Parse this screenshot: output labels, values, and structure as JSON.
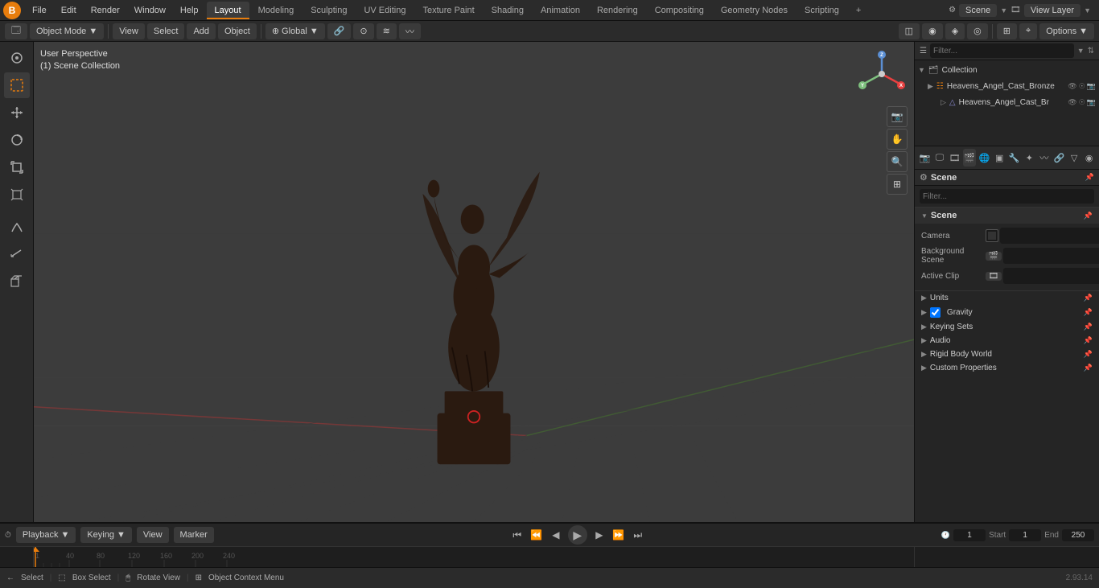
{
  "app": {
    "logo": "B",
    "version": "2.93.14"
  },
  "top_menu": {
    "items": [
      "File",
      "Edit",
      "Render",
      "Window",
      "Help"
    ]
  },
  "workspace_tabs": {
    "items": [
      "Layout",
      "Modeling",
      "Sculpting",
      "UV Editing",
      "Texture Paint",
      "Shading",
      "Animation",
      "Rendering",
      "Compositing",
      "Geometry Nodes",
      "Scripting"
    ],
    "active": "Layout",
    "plus_icon": "+"
  },
  "top_right": {
    "scene_label": "Scene",
    "view_layer_label": "View Layer"
  },
  "header_toolbar": {
    "object_mode": "Object Mode",
    "view": "View",
    "select": "Select",
    "add": "Add",
    "object": "Object",
    "transform": "Global",
    "options": "Options"
  },
  "viewport": {
    "info_line1": "User Perspective",
    "info_line2": "(1) Scene Collection",
    "gizmo_x_color": "#e84040",
    "gizmo_y_color": "#7ec07e",
    "gizmo_z_color": "#5b8fd4",
    "grid_color": "#3a3a3a",
    "axis_red": "#cc3333",
    "axis_green": "#6fa63f"
  },
  "outliner": {
    "title": "Scene Collection",
    "search_placeholder": "Filter...",
    "items": [
      {
        "label": "Heavens_Angel_Cast_Bronze",
        "icon": "▶",
        "indent": 0,
        "selected": false
      },
      {
        "label": "Heavens_Angel_Cast_Br",
        "icon": "▷",
        "indent": 1,
        "selected": false
      }
    ]
  },
  "properties": {
    "search_placeholder": "Filter...",
    "active_icon": "scene",
    "sections": [
      {
        "id": "scene",
        "label": "Scene",
        "collapsed": false,
        "subsections": [
          {
            "id": "scene_sub",
            "label": "Scene",
            "collapsed": false,
            "rows": [
              {
                "label": "Camera",
                "type": "field",
                "value": ""
              },
              {
                "label": "Background Scene",
                "type": "icon_field",
                "value": ""
              },
              {
                "label": "Active Clip",
                "type": "icon_field",
                "value": ""
              }
            ]
          },
          {
            "id": "units",
            "label": "Units",
            "collapsed": true
          },
          {
            "id": "gravity",
            "label": "Gravity",
            "collapsed": true,
            "checked": true
          },
          {
            "id": "keying_sets",
            "label": "Keying Sets",
            "collapsed": true
          },
          {
            "id": "audio",
            "label": "Audio",
            "collapsed": true
          },
          {
            "id": "rigid_body",
            "label": "Rigid Body World",
            "collapsed": true
          },
          {
            "id": "custom_props",
            "label": "Custom Properties",
            "collapsed": true
          }
        ]
      }
    ]
  },
  "timeline": {
    "playback_label": "Playback",
    "keying_label": "Keying",
    "view_label": "View",
    "marker_label": "Marker",
    "frame_current": "1",
    "start_label": "Start",
    "start_value": "1",
    "end_label": "End",
    "end_value": "250",
    "tick_marks": [
      "1",
      "40",
      "80",
      "120",
      "160",
      "200",
      "240"
    ],
    "tick_positions": [
      0,
      3,
      5,
      8,
      11,
      13,
      16,
      18,
      20,
      23,
      25,
      28,
      30,
      33,
      35,
      38,
      40,
      43,
      45,
      48,
      50,
      53,
      55,
      58,
      60,
      63,
      65,
      68,
      70,
      73,
      75,
      78,
      80,
      83,
      85,
      88,
      90,
      93,
      95,
      98,
      100
    ]
  },
  "footer": {
    "select_label": "Select",
    "box_select_label": "Box Select",
    "rotate_view_label": "Rotate View",
    "context_menu_label": "Object Context Menu"
  },
  "collection_label": "Collection"
}
